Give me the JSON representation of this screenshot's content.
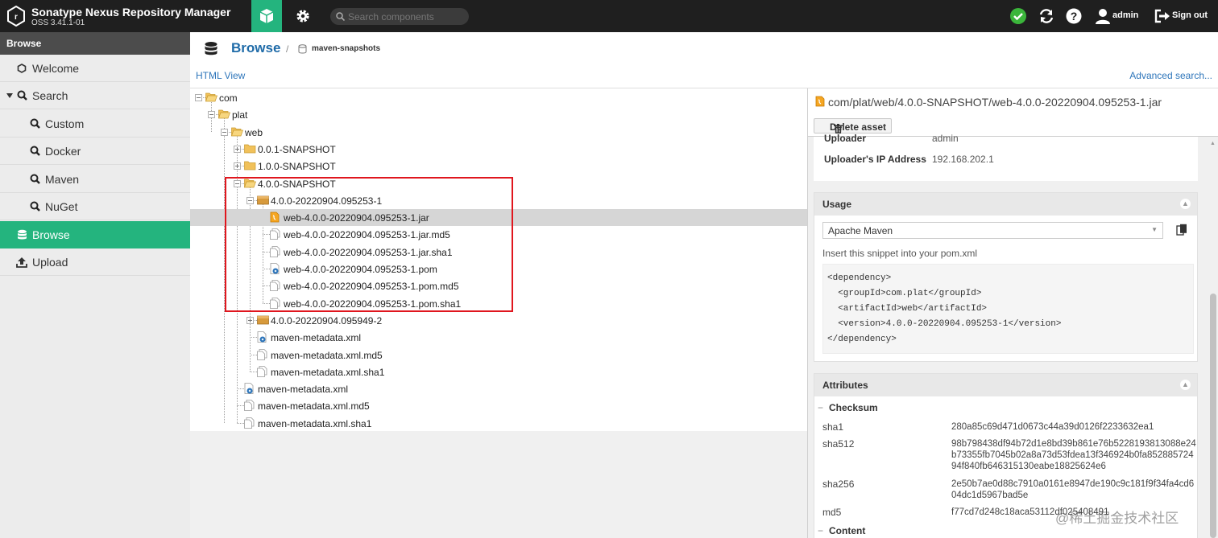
{
  "header": {
    "app_name": "Sonatype Nexus Repository Manager",
    "version": "OSS 3.41.1-01",
    "search_placeholder": "Search components",
    "user": "admin",
    "sign_out": "Sign out",
    "icons": [
      "browse-cube-icon",
      "gear-icon",
      "search-icon",
      "status-ok-icon",
      "refresh-icon",
      "help-icon",
      "user-icon",
      "sign-out-icon"
    ],
    "colors": {
      "bar": "#1f1f1f",
      "accent": "#24b47e"
    }
  },
  "sidebar": {
    "title": "Browse",
    "items": [
      {
        "label": "Welcome",
        "icon": "hexagon-icon"
      },
      {
        "label": "Search",
        "icon": "search-icon",
        "expanded": true
      },
      {
        "label": "Custom",
        "icon": "search-icon"
      },
      {
        "label": "Docker",
        "icon": "search-icon"
      },
      {
        "label": "Maven",
        "icon": "search-icon"
      },
      {
        "label": "NuGet",
        "icon": "search-icon"
      },
      {
        "label": "Browse",
        "icon": "database-icon",
        "active": true
      },
      {
        "label": "Upload",
        "icon": "upload-icon"
      }
    ]
  },
  "breadcrumb": {
    "root": "Browse",
    "separator": "/",
    "repository": "maven-snapshots"
  },
  "links": {
    "html_view": "HTML View",
    "advanced_search": "Advanced search..."
  },
  "tree": [
    {
      "label": "com"
    },
    {
      "label": "plat"
    },
    {
      "label": "web"
    },
    {
      "label": "0.0.1-SNAPSHOT"
    },
    {
      "label": "1.0.0-SNAPSHOT"
    },
    {
      "label": "4.0.0-SNAPSHOT"
    },
    {
      "label": "4.0.0-20220904.095253-1"
    },
    {
      "label": "web-4.0.0-20220904.095253-1.jar",
      "selected": true
    },
    {
      "label": "web-4.0.0-20220904.095253-1.jar.md5"
    },
    {
      "label": "web-4.0.0-20220904.095253-1.jar.sha1"
    },
    {
      "label": "web-4.0.0-20220904.095253-1.pom"
    },
    {
      "label": "web-4.0.0-20220904.095253-1.pom.md5"
    },
    {
      "label": "web-4.0.0-20220904.095253-1.pom.sha1"
    },
    {
      "label": "4.0.0-20220904.095949-2"
    },
    {
      "label": "maven-metadata.xml"
    },
    {
      "label": "maven-metadata.xml.md5"
    },
    {
      "label": "maven-metadata.xml.sha1"
    },
    {
      "label": "maven-metadata.xml"
    },
    {
      "label": "maven-metadata.xml.md5"
    },
    {
      "label": "maven-metadata.xml.sha1"
    }
  ],
  "detail": {
    "path": "com/plat/web/4.0.0-SNAPSHOT/web-4.0.0-20220904.095253-1.jar",
    "delete_label": "Delete asset",
    "summary": [
      {
        "key": "Uploader",
        "value": "admin"
      },
      {
        "key": "Uploader's IP Address",
        "value": "192.168.202.1"
      }
    ],
    "usage": {
      "title": "Usage",
      "format": "Apache Maven",
      "hint": "Insert this snippet into your pom.xml",
      "snippet": [
        "<dependency>",
        "  <groupId>com.plat</groupId>",
        "  <artifactId>web</artifactId>",
        "  <version>4.0.0-20220904.095253-1</version>",
        "</dependency>"
      ]
    },
    "attributes": {
      "title": "Attributes",
      "checksum_title": "Checksum",
      "rows": [
        {
          "key": "sha1",
          "value": "280a85c69d471d0673c44a39d0126f2233632ea1"
        },
        {
          "key": "sha512",
          "value": "98b798438df94b72d1e8bd39b861e76b5228193813088e24b73355fb7045b02a8a73d53fdea13f346924b0fa85288572494f840fb646315130eabe18825624e6"
        },
        {
          "key": "sha256",
          "value": "2e50b7ae0d88c7910a0161e8947de190c9c181f9f34fa4cd604dc1d5967bad5e"
        },
        {
          "key": "md5",
          "value": "f77cd7d248c18aca53112df025408491"
        }
      ],
      "content_title": "Content"
    }
  },
  "watermark": "@稀土掘金技术社区"
}
